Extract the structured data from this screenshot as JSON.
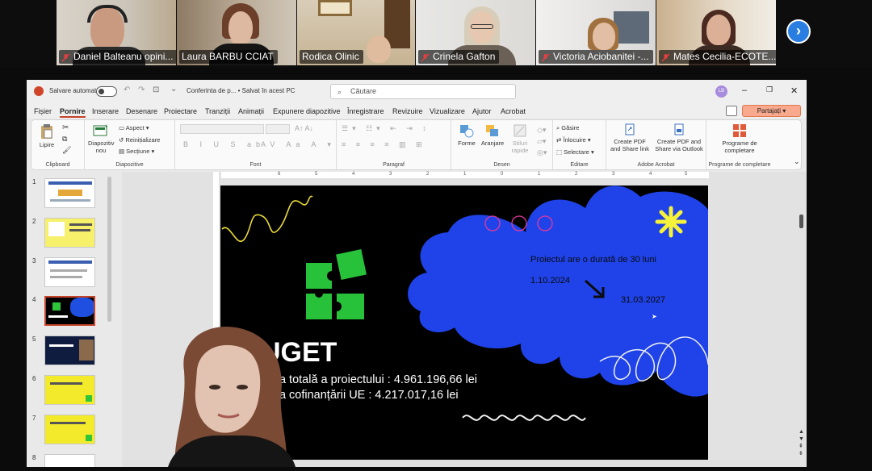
{
  "meeting": {
    "participants": [
      {
        "name": "Daniel Balteanu opini...",
        "muted": true
      },
      {
        "name": "Laura BARBU CCIAT",
        "muted": false,
        "speaking": true
      },
      {
        "name": "Rodica Olinic",
        "muted": false
      },
      {
        "name": "Crinela Gafton",
        "muted": true
      },
      {
        "name": "Victoria Aciobanitei -...",
        "muted": true
      },
      {
        "name": "Mates Cecilia-ECOTE...",
        "muted": true
      }
    ],
    "next_icon": "chevron-right-icon"
  },
  "ppt": {
    "autosave_label": "Salvare automată",
    "doc_title": "Conferinta de p... • Salvat în acest PC",
    "search_placeholder": "Căutare",
    "avatar_initials": "LB",
    "menu": [
      "Fișier",
      "Pornire",
      "Inserare",
      "Desenare",
      "Proiectare",
      "Tranziții",
      "Animații",
      "Expunere diapozitive",
      "Înregistrare",
      "Revizuire",
      "Vizualizare",
      "Ajutor",
      "Acrobat"
    ],
    "selected_menu": "Pornire",
    "share_label": "Partajați",
    "ribbon": {
      "clipboard": {
        "paste": "Lipire",
        "label": "Clipboard"
      },
      "slides": {
        "new_slide": "Diapozitiv nou",
        "layout": "Aspect",
        "reset": "Reinițializare",
        "section": "Secțiune",
        "label": "Diapozitive"
      },
      "font": {
        "label": "Font"
      },
      "paragraph": {
        "label": "Paragraf"
      },
      "drawing": {
        "shapes": "Forme",
        "arrange": "Aranjare",
        "quick_styles": "Stiluri rapide",
        "label": "Desen"
      },
      "editing": {
        "find": "Găsire",
        "replace": "Înlocuire",
        "select": "Selectare",
        "label": "Editare"
      },
      "acrobat": {
        "create_pdf": "Create PDF and Share link",
        "create_pdf_outlook": "Create PDF and Share via Outlook",
        "label": "Adobe Acrobat"
      },
      "addins": {
        "label_btn": "Programe de completare",
        "label": "Programe de completare"
      }
    },
    "thumbnails": [
      "1",
      "2",
      "3",
      "4",
      "5",
      "6",
      "7",
      "8"
    ],
    "selected_slide": "4",
    "ruler_ticks": [
      "6",
      "5",
      "4",
      "3",
      "2",
      "1",
      "0",
      "1",
      "2",
      "3",
      "4",
      "5",
      "6"
    ],
    "slide": {
      "duration": "Proiectul are o durată de 30 luni",
      "start_date": "1.10.2024",
      "end_date": "31.03.2027",
      "title": "UGET",
      "line1": "area totală a proiectului : 4.961.196,66 lei",
      "line2": "area cofinanțării UE : 4.217.017,16 lei"
    }
  }
}
